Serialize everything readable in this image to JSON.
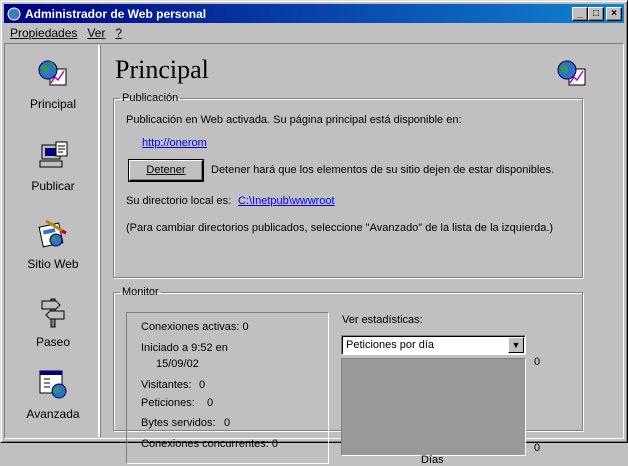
{
  "window": {
    "title": "Administrador de Web personal",
    "controls": {
      "minimize": "_",
      "maximize": "□",
      "close": "×"
    }
  },
  "menu": [
    {
      "label": "Propiedades"
    },
    {
      "label": "Ver"
    },
    {
      "label": "?"
    }
  ],
  "sidebar": {
    "items": [
      {
        "label": "Principal",
        "icon": "globe-chart-icon"
      },
      {
        "label": "Publicar",
        "icon": "computer-publish-icon"
      },
      {
        "label": "Sitio Web",
        "icon": "website-pencil-icon"
      },
      {
        "label": "Paseo",
        "icon": "signpost-icon"
      },
      {
        "label": "Avanzada",
        "icon": "window-globe-icon"
      }
    ]
  },
  "main": {
    "title": "Principal",
    "publicacion": {
      "legend": "Publicación",
      "status_text": "Publicación en Web activada. Su página principal está disponible en:",
      "home_link": "http://onerom",
      "stop_button": "Detener",
      "stop_hint": "Detener hará que los elementos de su sitio dejen de estar disponibles.",
      "local_dir_label": "Su directorio local es:",
      "local_dir_link": "C:\\Inetpub\\wwwroot",
      "advanced_hint": "(Para cambiar directorios publicados, seleccione \"Avanzado\" de la lista de la izquierda.)"
    },
    "monitor": {
      "legend": "Monitor",
      "active_connections": "Conexiones activas: 0",
      "started_label": "Iniciado a 9:52 en",
      "started_date": "15/09/02",
      "visitors_label": "Visitantes:",
      "visitors_value": "0",
      "requests_label": "Peticiones:",
      "requests_value": "0",
      "bytes_label": "Bytes servidos:",
      "bytes_value": "0",
      "concurrent": "Conexiones concurrentes: 0",
      "stats_label": "Ver estadísticas:",
      "stats_selected": "Peticiones por  día",
      "graph_top": "0",
      "graph_bottom": "0",
      "graph_xlabel": "Días"
    }
  },
  "colors": {
    "face": "#c0c0c0",
    "title_start": "#000080",
    "title_end": "#1084d0",
    "link": "#0000ff",
    "graph_bg": "#999999"
  }
}
